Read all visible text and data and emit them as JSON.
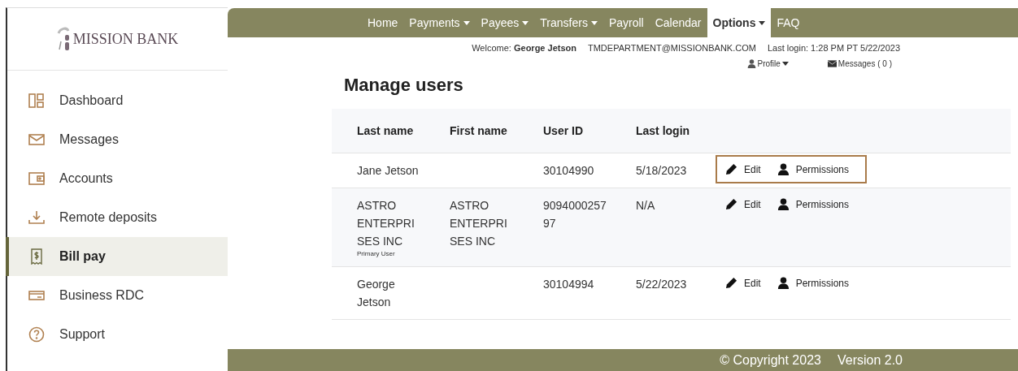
{
  "sidebar": {
    "logo": "MISSION BANK",
    "items": [
      {
        "label": "Dashboard",
        "selected": false
      },
      {
        "label": "Messages",
        "selected": false
      },
      {
        "label": "Accounts",
        "selected": false
      },
      {
        "label": "Remote deposits",
        "selected": false
      },
      {
        "label": "Bill pay",
        "selected": true
      },
      {
        "label": "Business RDC",
        "selected": false
      },
      {
        "label": "Support",
        "selected": false
      }
    ]
  },
  "top_nav": [
    {
      "label": "Home",
      "dropdown": false,
      "selected": false
    },
    {
      "label": "Payments",
      "dropdown": true,
      "selected": false
    },
    {
      "label": "Payees",
      "dropdown": true,
      "selected": false
    },
    {
      "label": "Transfers",
      "dropdown": true,
      "selected": false
    },
    {
      "label": "Payroll",
      "dropdown": false,
      "selected": false
    },
    {
      "label": "Calendar",
      "dropdown": false,
      "selected": false
    },
    {
      "label": "Options",
      "dropdown": true,
      "selected": true
    },
    {
      "label": "FAQ",
      "dropdown": false,
      "selected": false
    }
  ],
  "user_bar": {
    "welcome_label": "Welcome:",
    "user_name": "George Jetson",
    "email": "TMDEPARTMENT@MISSIONBANK.COM",
    "last_login": "Last login: 1:28 PM PT 5/22/2023",
    "profile": "Profile",
    "messages": "Messages ( 0 )"
  },
  "page_title": "Manage users",
  "table": {
    "columns": [
      "Last name",
      "First name",
      "User ID",
      "Last login"
    ],
    "rows": [
      {
        "last_name": [
          "Jane Jetson"
        ],
        "user_id": [
          "30104990"
        ],
        "last_login": "5/18/2023",
        "edit": "Edit",
        "permissions": "Permissions",
        "outlined": true
      },
      {
        "last_name": [
          "ASTRO",
          "ENTERPRI",
          "SES INC"
        ],
        "first_name": [
          "ASTRO",
          "ENTERPRI",
          "SES INC"
        ],
        "user_id": [
          "9094000257",
          "97"
        ],
        "last_login": "N/A",
        "note": "Primary User",
        "edit": "Edit",
        "permissions": "Permissions",
        "outlined": false
      },
      {
        "last_name": [
          "George",
          "Jetson"
        ],
        "user_id": [
          "30104994"
        ],
        "last_login": "5/22/2023",
        "edit": "Edit",
        "permissions": "Permissions",
        "outlined": false
      }
    ]
  },
  "footer": {
    "copyright": "© Copyright  2023",
    "version": "Version 2.0"
  }
}
